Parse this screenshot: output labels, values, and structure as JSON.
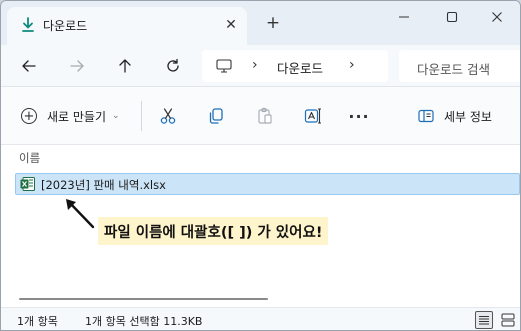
{
  "tab": {
    "title": "다운로드",
    "close": "✕"
  },
  "new_tab": "+",
  "window_controls": {
    "minimize": "minimize-icon",
    "maximize": "maximize-icon",
    "close": "close-icon"
  },
  "navigation": {
    "back": "back-arrow-icon",
    "forward": "forward-arrow-icon",
    "up": "up-arrow-icon",
    "refresh": "refresh-icon"
  },
  "address": {
    "separator": "›",
    "crumb": "다운로드"
  },
  "search": {
    "placeholder": "다운로드 검색"
  },
  "commands": {
    "new_label": "새로 만들기",
    "new_caret": "⌄",
    "more": "···",
    "details_label": "세부 정보"
  },
  "content": {
    "column_header": "이름",
    "files": [
      {
        "name": "[2023년] 판매 내역.xlsx",
        "icon": "excel-file-icon",
        "selected": true
      }
    ]
  },
  "annotation": {
    "text": "파일 이름에 대괄호([ ]) 가 있어요!"
  },
  "status": {
    "item_count": "1개 항목",
    "selection": "1개 항목 선택함 11.3KB"
  },
  "colors": {
    "accent": "#0067c0",
    "selection": "#cce4f7",
    "callout": "#fff5cc",
    "excel": "#1d6f42"
  }
}
